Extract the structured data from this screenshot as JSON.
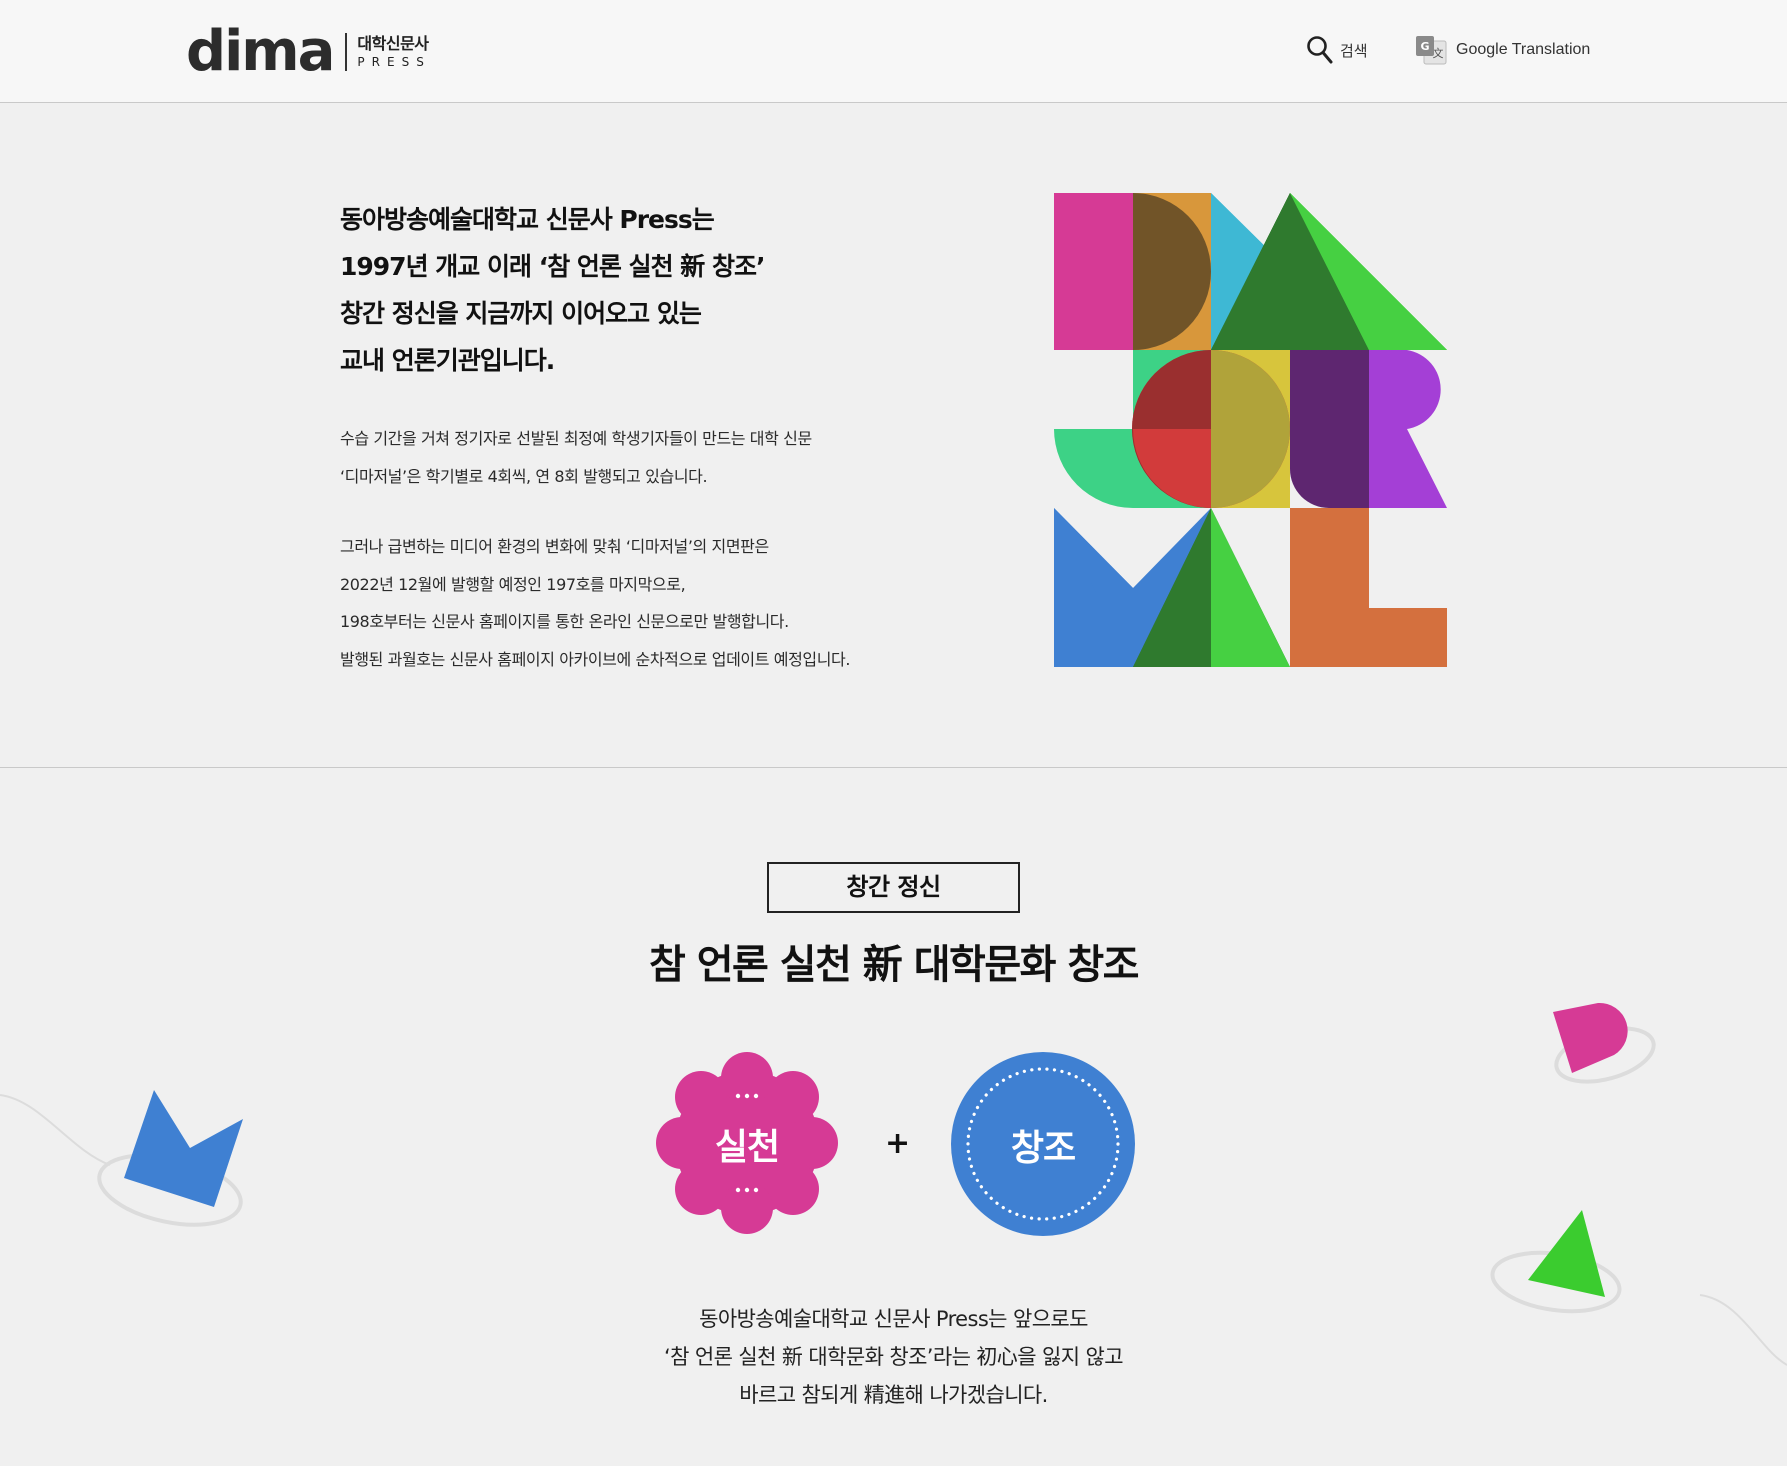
{
  "header": {
    "logo_word": "dima",
    "logo_kr": "대학신문사",
    "logo_en": "PRESS",
    "search_label": "검색",
    "translation_label": "Google Translation"
  },
  "intro": {
    "title_lines": [
      "동아방송예술대학교 신문사 Press는",
      "1997년 개교 이래 ‘참 언론 실천 新 창조’",
      "창간 정신을 지금까지 이어오고 있는",
      "교내 언론기관입니다."
    ],
    "paragraph1": [
      "수습 기간을 거쳐 정기자로 선발된 최정예 학생기자들이 만드는 대학 신문",
      "‘디마저널’은 학기별로 4회씩, 연 8회 발행되고 있습니다."
    ],
    "paragraph2": [
      "그러나 급변하는 미디어 환경의 변화에 맞춰 ‘디마저널’의 지면판은",
      "2022년 12월에 발행할 예정인 197호를 마지막으로,",
      "198호부터는 신문사 홈페이지를 통한 온라인 신문으로만 발행합니다.",
      "발행된 과월호는 신문사 홈페이지 아카이브에 순차적으로 업데이트 예정입니다."
    ]
  },
  "spirit": {
    "badge": "창간 정신",
    "title": "참 언론 실천 新 대학문화 창조",
    "flower_label": "실천",
    "plus": "+",
    "circle_label": "창조",
    "closing_lines": [
      "동아방송예술대학교 신문사 Press는 앞으로도",
      "‘참 언론 실천 新 대학문화 창조’라는 初心을 잃지 않고",
      "바르고 참되게 精進해 나가겠습니다."
    ]
  },
  "colors": {
    "pink": "#d63a95",
    "blue": "#3f80d2",
    "green": "#3bcc2f",
    "background": "#f0f0f0"
  }
}
